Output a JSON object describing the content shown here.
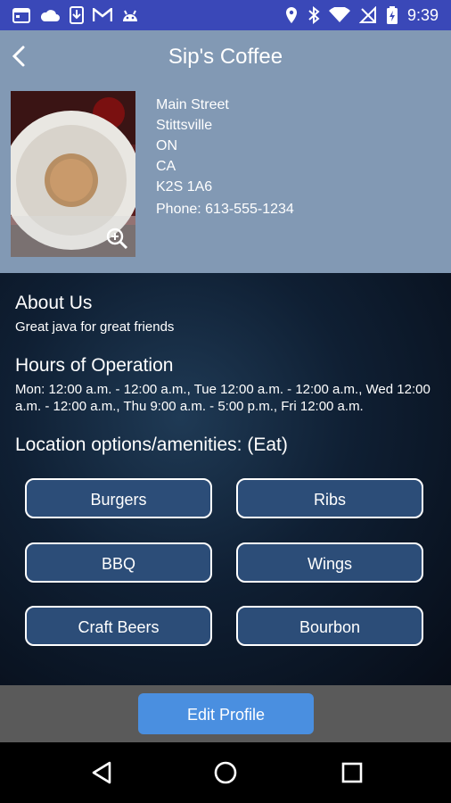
{
  "status_bar": {
    "time": "9:39",
    "icons_left": [
      "calendar-icon",
      "cloud-icon",
      "download-icon",
      "gmail-icon",
      "android-icon"
    ],
    "icons_right": [
      "location-icon",
      "bluetooth-icon",
      "wifi-icon",
      "no-signal-icon",
      "battery-charging-icon"
    ]
  },
  "header": {
    "title": "Sip's Coffee",
    "back_icon": "chevron-left-icon"
  },
  "business": {
    "address_lines": [
      "Main Street",
      "Stittsville",
      "ON",
      "CA",
      "K2S 1A6"
    ],
    "phone": "Phone: 613-555-1234",
    "photo_zoom_icon": "zoom-in-icon"
  },
  "about": {
    "heading": "About Us",
    "text": "Great java for great friends"
  },
  "hours": {
    "heading": "Hours of Operation",
    "text": "Mon: 12:00 a.m. - 12:00 a.m., Tue 12:00 a.m. - 12:00 a.m., Wed 12:00 a.m. - 12:00 a.m., Thu 9:00 a.m. - 5:00 p.m., Fri 12:00 a.m."
  },
  "amenities": {
    "heading": "Location options/amenities: (Eat)",
    "items": [
      "Burgers",
      "Ribs",
      "BBQ",
      "Wings",
      "Craft Beers",
      "Bourbon"
    ]
  },
  "footer": {
    "edit_label": "Edit Profile"
  },
  "nav": {
    "icons": [
      "back-triangle-icon",
      "home-circle-icon",
      "recents-square-icon"
    ]
  },
  "colors": {
    "status_bar": "#3a48b8",
    "header_bg": "#8299b4",
    "amenity_button": "#2c4d78",
    "edit_button": "#4a8fe0",
    "footer_bg": "#5a5a5a"
  }
}
